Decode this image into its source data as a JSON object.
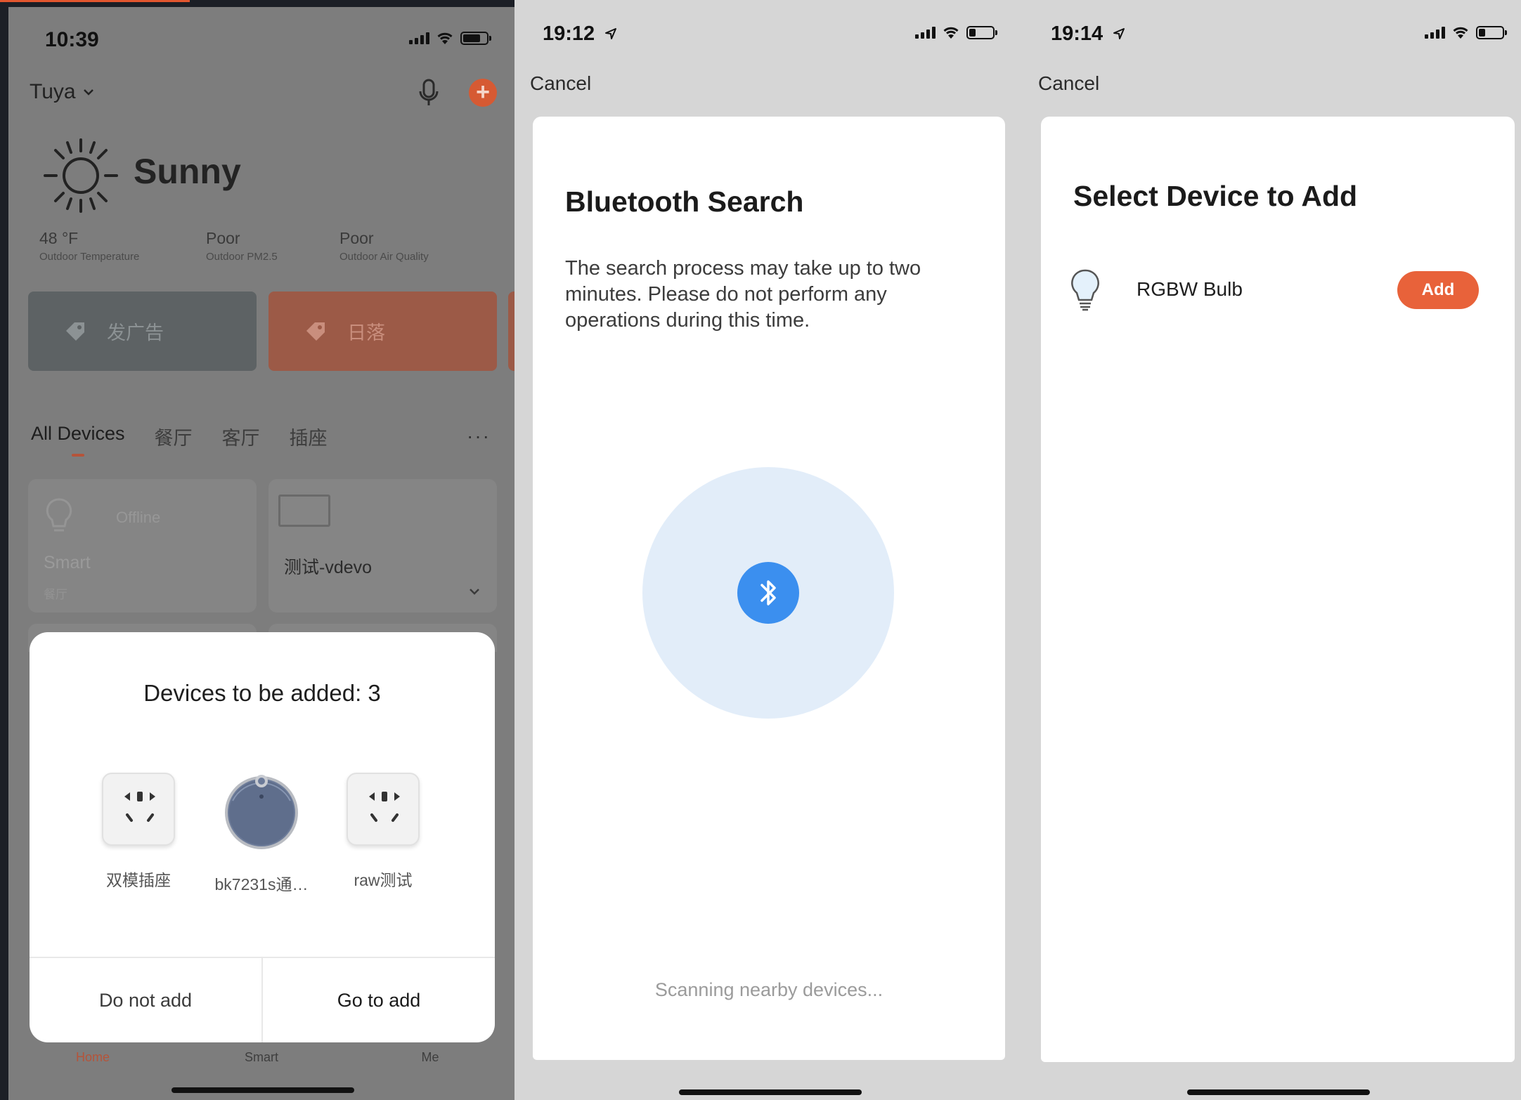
{
  "colors": {
    "accent": "#e8623a",
    "bluetooth_blue": "#3b8fef",
    "radar_light": "#e2edf9",
    "dim_overlay": "#7d7d7d"
  },
  "panel_home": {
    "status_time": "10:39",
    "home_name": "Tuya",
    "weather": {
      "condition": "Sunny",
      "stats": [
        {
          "value": "48 °F",
          "label": "Outdoor Temperature"
        },
        {
          "value": "Poor",
          "label": "Outdoor PM2.5"
        },
        {
          "value": "Poor",
          "label": "Outdoor Air Quality"
        }
      ]
    },
    "banners": [
      "发广告",
      "日落"
    ],
    "tabs": [
      "All Devices",
      "餐厅",
      "客厅",
      "插座"
    ],
    "more": "···",
    "device_cards": [
      {
        "name": "Smart",
        "status": "Offline",
        "room": "餐厅"
      },
      {
        "name": "测试-vdevo"
      }
    ],
    "bottom_tabs": [
      "Home",
      "Smart",
      "Me"
    ],
    "dialog": {
      "title": "Devices to be added: 3",
      "devices": [
        {
          "label": "双模插座",
          "icon": "socket-icon"
        },
        {
          "label": "bk7231s通…",
          "icon": "robot-vacuum-icon"
        },
        {
          "label": "raw测试",
          "icon": "socket-icon"
        }
      ],
      "cancel_label": "Do not add",
      "confirm_label": "Go to add"
    }
  },
  "panel_bluetooth": {
    "status_time": "19:12",
    "cancel_label": "Cancel",
    "title": "Bluetooth Search",
    "description": "The search process may take up to two minutes. Please do not perform any operations during this time.",
    "scanning_text": "Scanning nearby devices..."
  },
  "panel_select": {
    "status_time": "19:14",
    "cancel_label": "Cancel",
    "title": "Select Device to Add",
    "devices": [
      {
        "name": "RGBW Bulb",
        "button_label": "Add",
        "icon": "bulb-icon"
      }
    ]
  }
}
